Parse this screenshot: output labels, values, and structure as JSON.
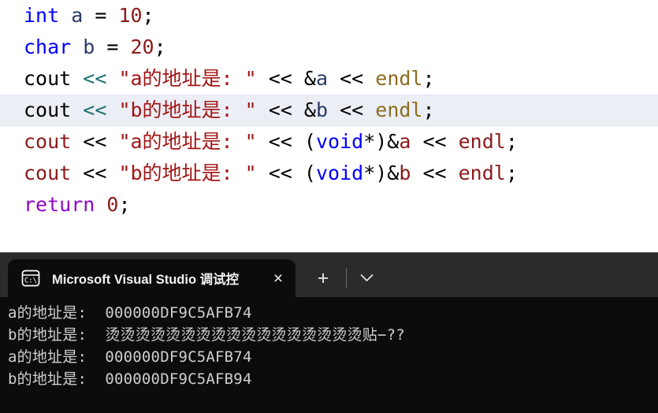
{
  "editor": {
    "current_line_index": 3,
    "lines": [
      {
        "id": "line-1",
        "tokens": [
          {
            "text": "int",
            "style": "kw"
          },
          {
            "text": " ",
            "style": "plain"
          },
          {
            "text": "a",
            "style": "var"
          },
          {
            "text": " = ",
            "style": "plain"
          },
          {
            "text": "10",
            "style": "num"
          },
          {
            "text": ";",
            "style": "plain"
          }
        ]
      },
      {
        "id": "line-2",
        "tokens": [
          {
            "text": "char",
            "style": "kw"
          },
          {
            "text": " ",
            "style": "plain"
          },
          {
            "text": "b",
            "style": "var"
          },
          {
            "text": " = ",
            "style": "plain"
          },
          {
            "text": "20",
            "style": "num"
          },
          {
            "text": ";",
            "style": "plain"
          }
        ]
      },
      {
        "id": "line-3",
        "tokens": [
          {
            "text": "cout ",
            "style": "plain"
          },
          {
            "text": "<<",
            "style": "op-teal"
          },
          {
            "text": " ",
            "style": "plain"
          },
          {
            "text": "\"a的地址是: \"",
            "style": "str"
          },
          {
            "text": " << ",
            "style": "plain"
          },
          {
            "text": "&",
            "style": "plain"
          },
          {
            "text": "a",
            "style": "var"
          },
          {
            "text": " << ",
            "style": "plain"
          },
          {
            "text": "endl",
            "style": "fn"
          },
          {
            "text": ";",
            "style": "plain"
          }
        ]
      },
      {
        "id": "line-4",
        "tokens": [
          {
            "text": "cout ",
            "style": "plain"
          },
          {
            "text": "<<",
            "style": "op-teal"
          },
          {
            "text": " ",
            "style": "plain"
          },
          {
            "text": "\"b的地址是: \"",
            "style": "str"
          },
          {
            "text": " << ",
            "style": "plain"
          },
          {
            "text": "&",
            "style": "plain"
          },
          {
            "text": "b",
            "style": "var"
          },
          {
            "text": " << ",
            "style": "plain"
          },
          {
            "text": "endl",
            "style": "fn"
          },
          {
            "text": ";",
            "style": "plain"
          }
        ]
      },
      {
        "id": "line-5",
        "tokens": [
          {
            "text": "cout",
            "style": "dred"
          },
          {
            "text": " << ",
            "style": "plain"
          },
          {
            "text": "\"a的地址是: \"",
            "style": "str"
          },
          {
            "text": " << (",
            "style": "plain"
          },
          {
            "text": "void",
            "style": "kw"
          },
          {
            "text": "*)&",
            "style": "plain"
          },
          {
            "text": "a",
            "style": "dred"
          },
          {
            "text": " << ",
            "style": "plain"
          },
          {
            "text": "endl",
            "style": "dred"
          },
          {
            "text": ";",
            "style": "plain"
          }
        ]
      },
      {
        "id": "line-6",
        "tokens": [
          {
            "text": "cout",
            "style": "dred"
          },
          {
            "text": " << ",
            "style": "plain"
          },
          {
            "text": "\"b的地址是: \"",
            "style": "str"
          },
          {
            "text": " << (",
            "style": "plain"
          },
          {
            "text": "void",
            "style": "kw"
          },
          {
            "text": "*)&",
            "style": "plain"
          },
          {
            "text": "b",
            "style": "dred"
          },
          {
            "text": " << ",
            "style": "plain"
          },
          {
            "text": "endl",
            "style": "dred"
          },
          {
            "text": ";",
            "style": "plain"
          }
        ]
      },
      {
        "id": "line-7",
        "tokens": [
          {
            "text": "return",
            "style": "ctl"
          },
          {
            "text": " ",
            "style": "plain"
          },
          {
            "text": "0",
            "style": "num"
          },
          {
            "text": ";",
            "style": "plain"
          }
        ]
      }
    ]
  },
  "terminal": {
    "tab": {
      "icon": "console-cmd-icon",
      "title": "Microsoft Visual Studio 调试控",
      "close_label": "×"
    },
    "actions": {
      "new_tab_label": "+",
      "menu_label": "⌄"
    },
    "console": {
      "lines": [
        "a的地址是:  000000DF9C5AFB74",
        "b的地址是:  烫烫烫烫烫烫烫烫烫烫烫烫烫烫烫烫烫贴−??",
        "a的地址是:  000000DF9C5AFB74",
        "b的地址是:  000000DF9C5AFB94"
      ]
    }
  },
  "colors": {
    "editor_bg": "#ffffff",
    "current_line_bg": "#eceef6",
    "terminal_frame": "#2b2b2b",
    "console_bg": "#0c0c0c",
    "console_fg": "#cfcfcf",
    "keyword": "#0000ff",
    "control_keyword": "#8f08c4",
    "string": "#a31515",
    "number": "#8b1a1a",
    "stream_op": "#1a7070",
    "endl": "#8a6d1f"
  }
}
